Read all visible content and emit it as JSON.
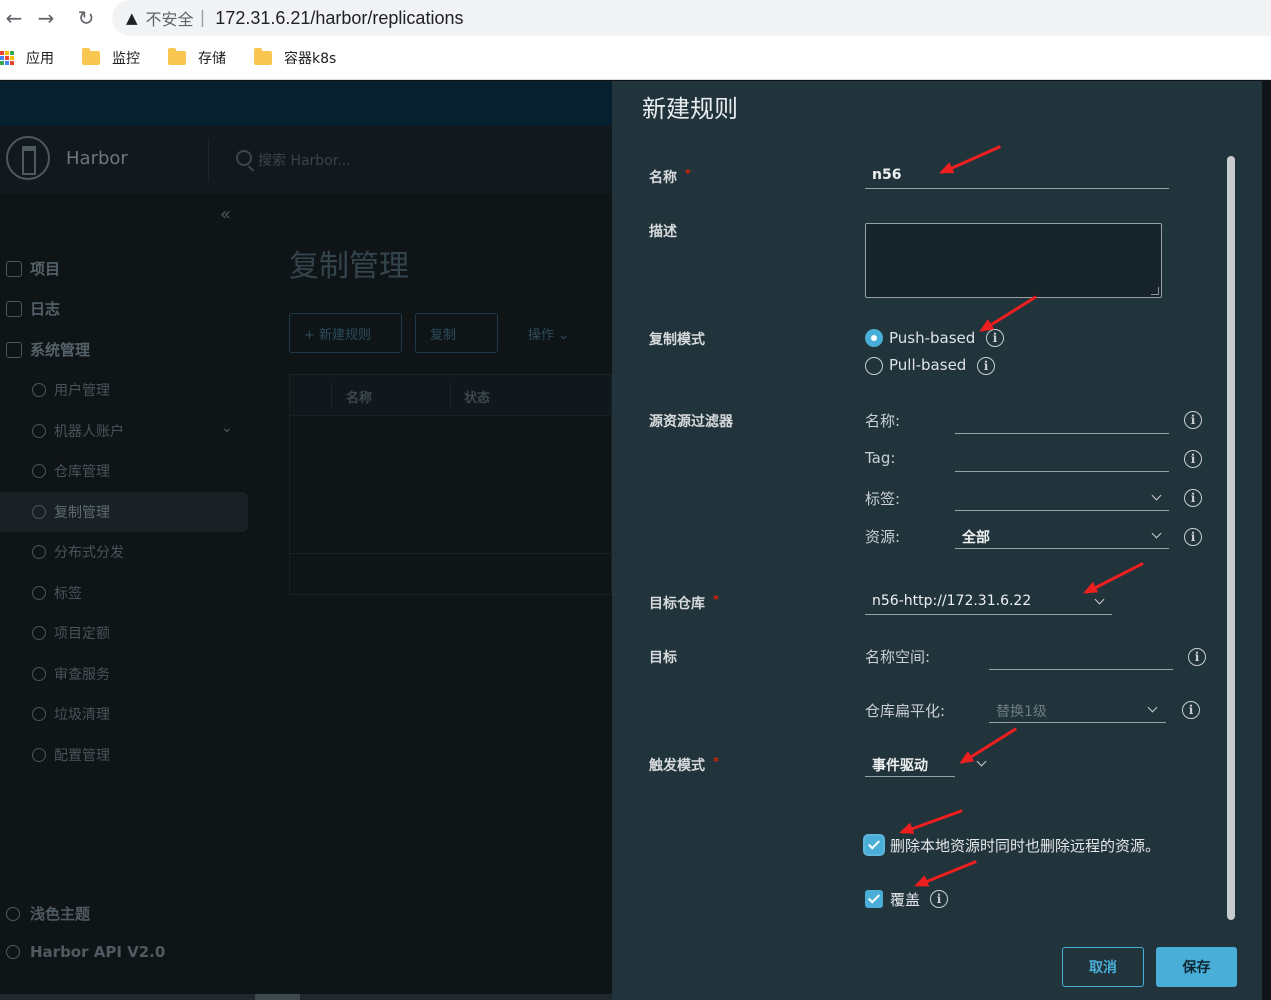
{
  "browser": {
    "back_icon": "←",
    "forward_icon": "→",
    "reload_icon": "↻",
    "warn_icon": "▲",
    "insecure_label": "不安全",
    "separator": "|",
    "url": "172.31.6.21/harbor/replications",
    "bookmarks": [
      "应用",
      "监控",
      "存储",
      "容器k8s"
    ]
  },
  "app": {
    "brand": "Harbor",
    "search_placeholder": "搜索 Harbor...",
    "collapse_icon": "«",
    "nav": {
      "projects": "项目",
      "logs": "日志",
      "system_admin": "系统管理",
      "users": "用户管理",
      "robots": "机器人账户",
      "registries": "仓库管理",
      "replications": "复制管理",
      "distributions": "分布式分发",
      "labels": "标签",
      "quotas": "项目定额",
      "audit": "审查服务",
      "gc": "垃圾清理",
      "config": "配置管理"
    },
    "page_title": "复制管理",
    "toolbar": {
      "new_rule": "+ 新建规则",
      "copy": "复制",
      "actions": "操作"
    },
    "grid_columns": [
      "名称",
      "状态"
    ],
    "theme_toggle": "浅色主题",
    "api_link": "Harbor API V2.0"
  },
  "modal": {
    "title": "新建规则",
    "name_label": "名称",
    "name_value": "n56",
    "desc_label": "描述",
    "desc_value": "",
    "mode_label": "复制模式",
    "mode_push": "Push-based",
    "mode_pull": "Pull-based",
    "mode_selected": "Push-based",
    "filter_label": "源资源过滤器",
    "filter_name_label": "名称:",
    "filter_name_value": "",
    "filter_tag_label": "Tag:",
    "filter_tag_value": "",
    "filter_labels_label": "标签:",
    "filter_labels_value": "",
    "filter_resource_label": "资源:",
    "filter_resource_value": "全部",
    "dest_registry_label": "目标仓库",
    "dest_registry_value": "n56-http://172.31.6.22",
    "dest_label": "目标",
    "namespace_label": "名称空间:",
    "namespace_value": "",
    "flatten_label": "仓库扁平化:",
    "flatten_value": "替换1级",
    "trigger_label": "触发模式",
    "trigger_value": "事件驱动",
    "delete_remote_label": "删除本地资源时同时也删除远程的资源。",
    "delete_remote_checked": true,
    "override_label": "覆盖",
    "override_checked": true,
    "cancel_label": "取消",
    "save_label": "保存",
    "required_mark": "*",
    "info_glyph": "i"
  },
  "colors": {
    "accent": "#49afd9",
    "annotation_arrow": "#ee1f1f",
    "modal_bg": "#21333b"
  }
}
